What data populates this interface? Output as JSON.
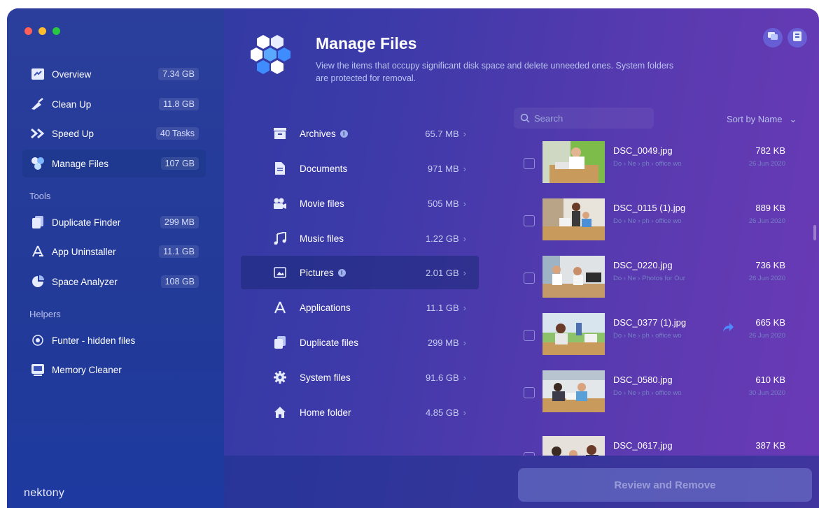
{
  "window": {
    "controls": [
      "close",
      "minimize",
      "zoom"
    ]
  },
  "sidebar": {
    "items": [
      {
        "label": "Overview",
        "badge": "7.34 GB",
        "icon": "overview-icon"
      },
      {
        "label": "Clean Up",
        "badge": "11.8 GB",
        "icon": "clean-up-icon"
      },
      {
        "label": "Speed Up",
        "badge": "40 Tasks",
        "icon": "speed-up-icon"
      },
      {
        "label": "Manage Files",
        "badge": "107 GB",
        "icon": "manage-files-icon",
        "active": true
      }
    ],
    "tools_heading": "Tools",
    "tools": [
      {
        "label": "Duplicate Finder",
        "badge": "299 MB",
        "icon": "duplicate-finder-icon"
      },
      {
        "label": "App Uninstaller",
        "badge": "11.1 GB",
        "icon": "app-uninstaller-icon"
      },
      {
        "label": "Space Analyzer",
        "badge": "108 GB",
        "icon": "space-analyzer-icon"
      }
    ],
    "helpers_heading": "Helpers",
    "helpers": [
      {
        "label": "Funter - hidden files",
        "icon": "funter-icon"
      },
      {
        "label": "Memory Cleaner",
        "icon": "memory-cleaner-icon"
      }
    ],
    "logo": "nektony"
  },
  "header": {
    "title": "Manage Files",
    "subtitle": "View the items that occupy significant disk space and delete unneeded ones. System folders are protected for removal.",
    "buttons": [
      "chat-icon",
      "news-icon"
    ]
  },
  "categories": [
    {
      "label": "Archives",
      "size": "65.7 MB",
      "icon": "archive-icon",
      "info": true
    },
    {
      "label": "Documents",
      "size": "971 MB",
      "icon": "document-icon"
    },
    {
      "label": "Movie files",
      "size": "505 MB",
      "icon": "movie-icon"
    },
    {
      "label": "Music files",
      "size": "1.22 GB",
      "icon": "music-icon"
    },
    {
      "label": "Pictures",
      "size": "2.01 GB",
      "icon": "picture-icon",
      "info": true,
      "active": true
    },
    {
      "label": "Applications",
      "size": "11.1 GB",
      "icon": "applications-icon"
    },
    {
      "label": "Duplicate files",
      "size": "299 MB",
      "icon": "duplicate-files-icon"
    },
    {
      "label": "System files",
      "size": "91.6 GB",
      "icon": "gear-icon"
    },
    {
      "label": "Home folder",
      "size": "4.85 GB",
      "icon": "home-icon"
    }
  ],
  "search": {
    "placeholder": "Search"
  },
  "sort": {
    "label": "Sort by Name"
  },
  "files": [
    {
      "name": "DSC_0049.jpg",
      "size": "782 KB",
      "path": "Do › Ne › ph › office wo",
      "date": "26 Jun 2020"
    },
    {
      "name": "DSC_0115 (1).jpg",
      "size": "889 KB",
      "path": "Do › Ne › ph › office wo",
      "date": "26 Jun 2020"
    },
    {
      "name": "DSC_0220.jpg",
      "size": "736 KB",
      "path": "Do › Ne › Photos for Our",
      "date": "26 Jun 2020"
    },
    {
      "name": "DSC_0377 (1).jpg",
      "size": "665 KB",
      "path": "Do › Ne › ph › office wo",
      "date": "26 Jun 2020",
      "shared": true
    },
    {
      "name": "DSC_0580.jpg",
      "size": "610 KB",
      "path": "Do › Ne › ph › office wo",
      "date": "30 Jun 2020"
    },
    {
      "name": "DSC_0617.jpg",
      "size": "387 KB",
      "path": "",
      "date": ""
    }
  ],
  "actions": {
    "review_label": "Review and Remove"
  },
  "colors": {
    "accent": "#3a3aa8",
    "sidebar": "#223a98",
    "close": "#ff5f57",
    "minimize": "#febc2e",
    "zoom": "#28c840"
  }
}
